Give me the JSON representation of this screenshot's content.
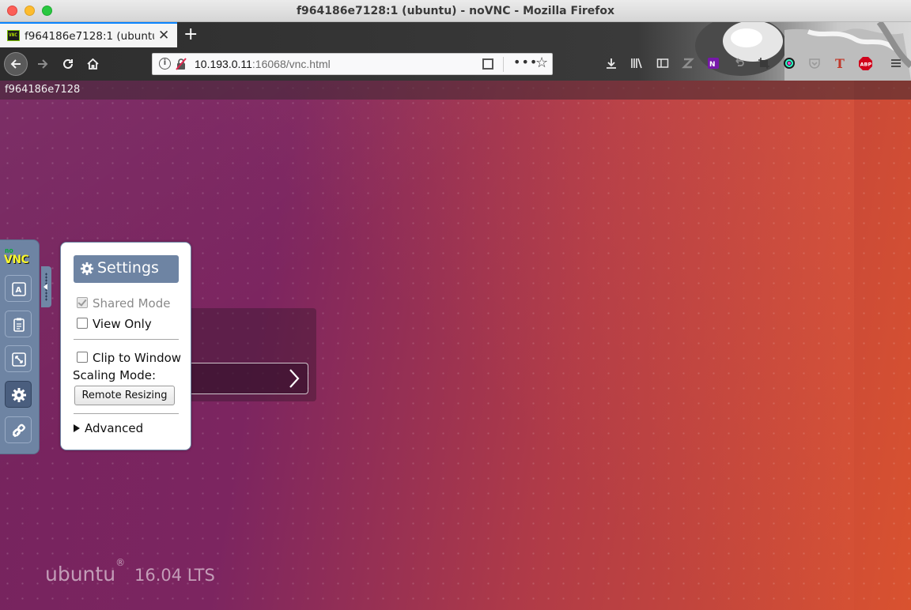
{
  "window": {
    "title": "f964186e7128:1 (ubuntu) - noVNC - Mozilla Firefox"
  },
  "browser": {
    "tab": {
      "title": "f964186e7128:1 (ubuntu)",
      "favicon": "novnc-favicon"
    },
    "urlbar": {
      "host": "10.193.0.11",
      "path": ":16068/vnc.html"
    },
    "toolbar_icons": [
      "download-icon",
      "library-icon",
      "sidebar-icon",
      "zotero-icon",
      "onenote-icon",
      "undo-icon",
      "screenshot-icon",
      "color-picker-icon",
      "pocket-icon",
      "tt-icon",
      "adblock-plus-icon",
      "menu-icon"
    ],
    "adblock_label": "ABP"
  },
  "vnc": {
    "status_name": "f964186e7128",
    "ubuntu_brand": "ubuntu",
    "ubuntu_version": "16.04 LTS",
    "logo": {
      "top": "no",
      "bottom": "VNC"
    }
  },
  "controlbar": {
    "buttons": [
      "keyboard-icon",
      "clipboard-icon",
      "fullscreen-icon",
      "settings-icon",
      "disconnect-icon"
    ],
    "active": "settings-icon"
  },
  "settings": {
    "title": "Settings",
    "shared_mode": {
      "label": "Shared Mode",
      "checked": true,
      "disabled": true
    },
    "view_only": {
      "label": "View Only",
      "checked": false
    },
    "clip_to_window": {
      "label": "Clip to Window",
      "checked": false
    },
    "scaling_mode_label": "Scaling Mode:",
    "scaling_mode_value": "Remote Resizing",
    "advanced_label": "Advanced"
  }
}
